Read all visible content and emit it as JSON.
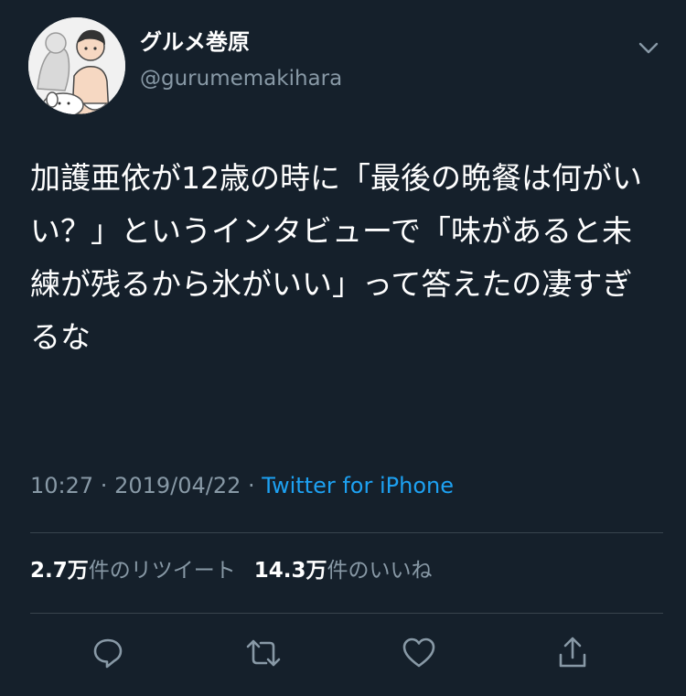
{
  "user": {
    "display_name": "グルメ巻原",
    "handle": "@gurumemakihara"
  },
  "tweet": {
    "text": "加護亜依が12歳の時に「最後の晩餐は何がいい？」というインタビューで「味があると未練が残るから氷がいい」って答えたの凄すぎるな",
    "time": "10:27",
    "separator1": " · ",
    "date": "2019/04/22",
    "separator2": " · ",
    "source": "Twitter for iPhone"
  },
  "stats": {
    "retweets_count": "2.7万",
    "retweets_label": "件のリツイート",
    "likes_count": "14.3万",
    "likes_label": "件のいいね"
  },
  "actions": {
    "icons": [
      "reply-icon",
      "retweet-icon",
      "like-icon",
      "share-icon"
    ]
  },
  "colors": {
    "background": "#15202b",
    "text_primary": "#ffffff",
    "text_secondary": "#8899a6",
    "accent": "#1da1f2",
    "divider": "#38444d"
  }
}
